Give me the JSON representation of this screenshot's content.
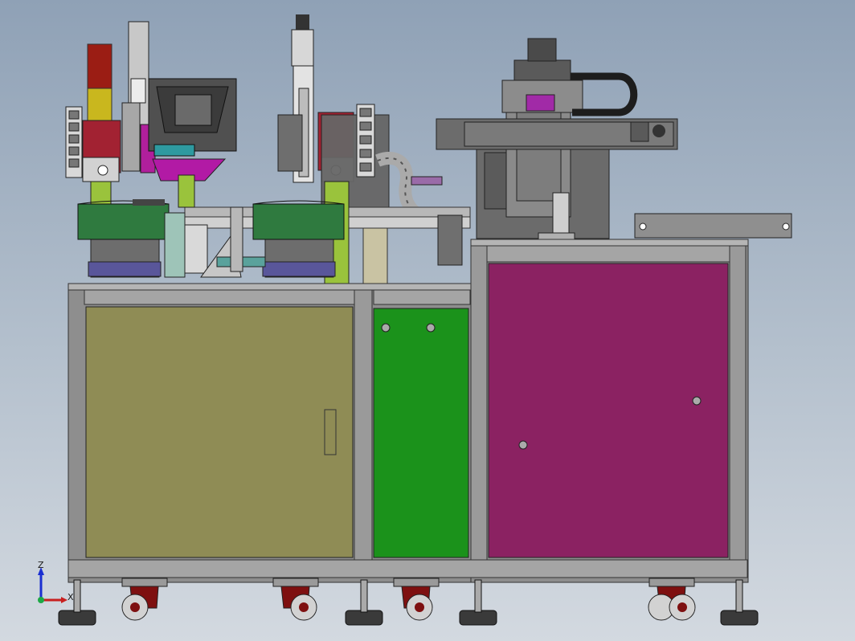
{
  "viewport": {
    "background_top": "#8fa1b6",
    "background_bottom": "#d3d9e0"
  },
  "colors": {
    "frame_gray": "#8e8e8e",
    "frame_dark": "#5c5c5c",
    "left_panel": "#8f8c55",
    "center_panel": "#1b921b",
    "right_panel": "#8b2262",
    "bowl_green": "#2f7a3f",
    "bowl_blue": "#59569a",
    "caster_red": "#7e1010",
    "accent_magenta": "#b21aa5",
    "light_green": "#9ac33c",
    "signal_red": "#9b1d14",
    "signal_yellow": "#c9b71e",
    "signal_green": "#3a8d2e"
  },
  "triad": {
    "z_label": "Z",
    "x_label": "X",
    "icon": "coordinate-triad-icon"
  }
}
